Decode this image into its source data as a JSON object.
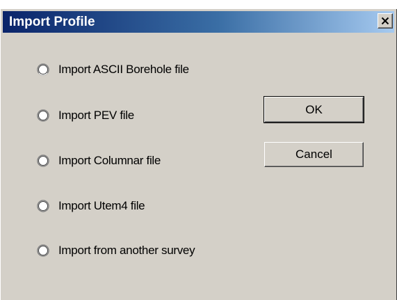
{
  "dialog": {
    "title": "Import Profile",
    "close_icon": "close-x-icon"
  },
  "options": [
    {
      "label": "Import ASCII Borehole file",
      "selected": false
    },
    {
      "label": "Import PEV file",
      "selected": false
    },
    {
      "label": "Import Columnar file",
      "selected": false
    },
    {
      "label": "Import Utem4 file",
      "selected": false
    },
    {
      "label": "Import from another survey",
      "selected": false
    }
  ],
  "buttons": {
    "ok_label": "OK",
    "cancel_label": "Cancel"
  },
  "colors": {
    "face": "#d4d0c8",
    "title_start": "#0a246a",
    "title_end": "#a6caf0"
  }
}
